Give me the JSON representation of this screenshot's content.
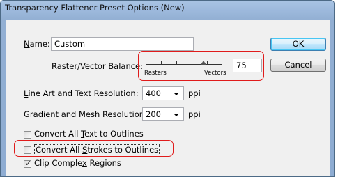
{
  "window": {
    "title": "Transparency Flattener Preset Options (New)"
  },
  "name": {
    "label": "Name:",
    "value": "Custom"
  },
  "balance": {
    "label": "Raster/Vector Balance:",
    "value": "75",
    "min_label": "Rasters",
    "max_label": "Vectors",
    "position": 0.75
  },
  "line_art": {
    "label": "Line Art and Text Resolution:",
    "value": "400",
    "unit": "ppi"
  },
  "gradient": {
    "label": "Gradient and Mesh Resolution:",
    "value": "200",
    "unit": "ppi"
  },
  "options": [
    {
      "label": "Convert All Text to Outlines",
      "checked": false
    },
    {
      "label": "Convert All Strokes to Outlines",
      "checked": true
    },
    {
      "label": "Clip Complex Regions",
      "checked": true
    }
  ],
  "buttons": {
    "ok": "OK",
    "cancel": "Cancel"
  },
  "colors": {
    "highlight": "#e01b1b",
    "title_bar": "#a9c4e4"
  }
}
